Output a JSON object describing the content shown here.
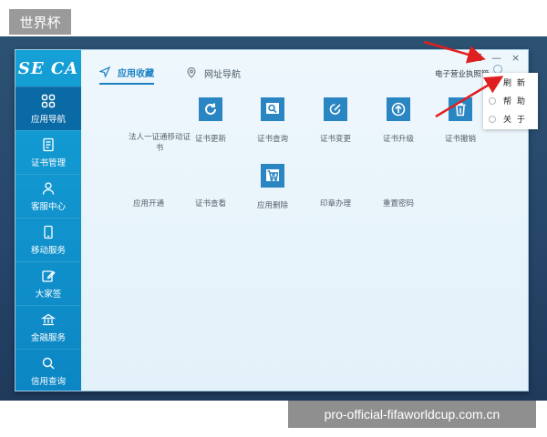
{
  "corner_tag": "世界杯",
  "watermark": "pro-official-fifaworldcup.com.cn",
  "app": {
    "logo_text": "SE CA",
    "tabs": [
      {
        "label": "应用收藏",
        "icon": "send-icon",
        "active": true
      },
      {
        "label": "网址导航",
        "icon": "location-pin-icon",
        "active": false
      }
    ],
    "right_hint": "电子营业执照管",
    "window_controls": {
      "menu": "☰",
      "minimize": "—",
      "close": "×"
    }
  },
  "sidebar": {
    "items": [
      {
        "label": "应用导航",
        "icon": "grid-icon",
        "active": true
      },
      {
        "label": "证书管理",
        "icon": "document-icon",
        "active": false
      },
      {
        "label": "客服中心",
        "icon": "user-icon",
        "active": false
      },
      {
        "label": "移动服务",
        "icon": "phone-icon",
        "active": false
      },
      {
        "label": "大家签",
        "icon": "edit-icon",
        "active": false
      },
      {
        "label": "金融服务",
        "icon": "bank-icon",
        "active": false
      },
      {
        "label": "信用查询",
        "icon": "search-icon",
        "active": false
      }
    ]
  },
  "apps_row1": [
    {
      "label": "法人一证通移动证书",
      "icon": null
    },
    {
      "label": "证书更新",
      "icon": "refresh-icon"
    },
    {
      "label": "证书查询",
      "icon": "search-icon"
    },
    {
      "label": "证书变更",
      "icon": "edit-icon"
    },
    {
      "label": "证书升级",
      "icon": "upload-icon"
    },
    {
      "label": "证书撤销",
      "icon": "trash-icon"
    }
  ],
  "apps_row2": [
    {
      "label": "应用开通",
      "icon": null
    },
    {
      "label": "证书查看",
      "icon": null
    },
    {
      "label": "应用删除",
      "icon": "cart-delete-icon"
    },
    {
      "label": "印章办理",
      "icon": null
    },
    {
      "label": "重置密码",
      "icon": null
    }
  ],
  "context_menu": [
    {
      "label": "刷新"
    },
    {
      "label": "帮助"
    },
    {
      "label": "关于"
    }
  ],
  "colors": {
    "accent": "#1b80c3",
    "sidebar": "#0c86c4",
    "tile": "#2a86c2",
    "arrow": "#e02020"
  }
}
